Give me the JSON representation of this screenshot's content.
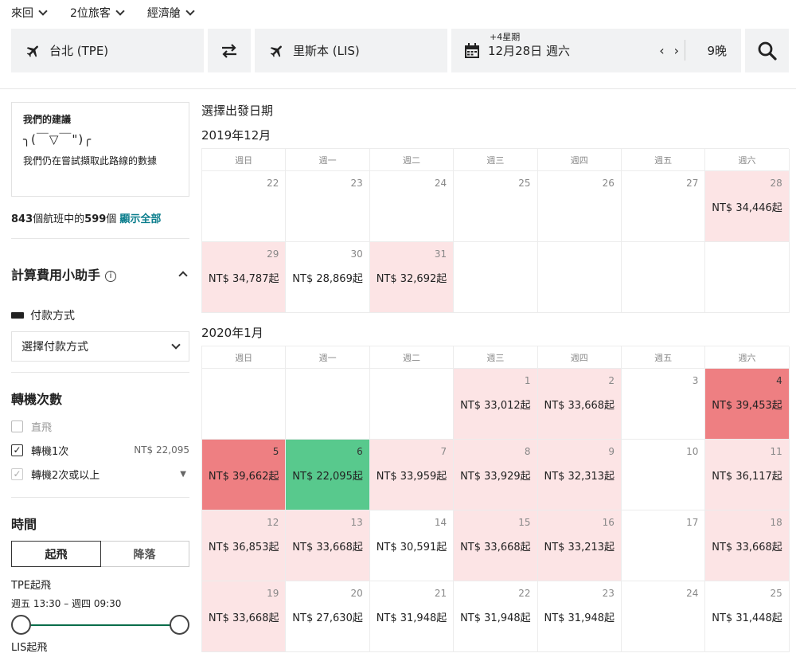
{
  "top_options": {
    "trip_type": "來回",
    "passengers": "2位旅客",
    "cabin": "經濟艙"
  },
  "search": {
    "from": "台北 (TPE)",
    "to": "里斯本 (LIS)",
    "weeks_badge": "+4星期",
    "date": "12月28日 週六",
    "prev": "‹",
    "next": "›",
    "nights": "9晚"
  },
  "sidebar": {
    "suggest_title": "我們的建議",
    "suggest_face": "╮(￣▽￣\")╭",
    "suggest_text": "我們仍在嘗試擷取此路線的數據",
    "count_total": "843",
    "count_mid": "個航班中的",
    "count_shown": "599",
    "count_unit": "個",
    "show_all": "顯示全部",
    "calc_title": "計算費用小助手",
    "pay_label": "付款方式",
    "pay_select": "選擇付款方式",
    "stops_title": "轉機次數",
    "stops": [
      {
        "label": "直飛",
        "checked": false,
        "price": "",
        "dim": true
      },
      {
        "label": "轉機1次",
        "checked": true,
        "price": "NT$ 22,095",
        "dim": false
      },
      {
        "label": "轉機2次或以上",
        "checked": true,
        "price": "",
        "dim": false
      }
    ],
    "time_title": "時間",
    "tab_depart": "起飛",
    "tab_arrive": "降落",
    "tpe_label": "TPE起飛",
    "tpe_range": "週五 13:30 – 週四 09:30",
    "lis_label": "LIS起飛"
  },
  "calendar": {
    "heading": "選擇出發日期",
    "weekdays": [
      "週日",
      "週一",
      "週二",
      "週三",
      "週四",
      "週五",
      "週六"
    ],
    "months": [
      {
        "title": "2019年12月",
        "weeks": [
          [
            {
              "n": "22",
              "p": "",
              "c": ""
            },
            {
              "n": "23",
              "p": "",
              "c": ""
            },
            {
              "n": "24",
              "p": "",
              "c": ""
            },
            {
              "n": "25",
              "p": "",
              "c": ""
            },
            {
              "n": "26",
              "p": "",
              "c": ""
            },
            {
              "n": "27",
              "p": "",
              "c": ""
            },
            {
              "n": "28",
              "p": "NT$ 34,446起",
              "c": "pink"
            }
          ],
          [
            {
              "n": "29",
              "p": "NT$ 34,787起",
              "c": "pink"
            },
            {
              "n": "30",
              "p": "NT$ 28,869起",
              "c": ""
            },
            {
              "n": "31",
              "p": "NT$ 32,692起",
              "c": "pink"
            },
            {
              "n": "",
              "p": "",
              "c": "empty"
            },
            {
              "n": "",
              "p": "",
              "c": "empty"
            },
            {
              "n": "",
              "p": "",
              "c": "empty"
            },
            {
              "n": "",
              "p": "",
              "c": "empty"
            }
          ]
        ]
      },
      {
        "title": "2020年1月",
        "weeks": [
          [
            {
              "n": "",
              "p": "",
              "c": "empty"
            },
            {
              "n": "",
              "p": "",
              "c": "empty"
            },
            {
              "n": "",
              "p": "",
              "c": "empty"
            },
            {
              "n": "1",
              "p": "NT$ 33,012起",
              "c": "pink"
            },
            {
              "n": "2",
              "p": "NT$ 33,668起",
              "c": "pink"
            },
            {
              "n": "3",
              "p": "",
              "c": ""
            },
            {
              "n": "4",
              "p": "NT$ 39,453起",
              "c": "red"
            }
          ],
          [
            {
              "n": "5",
              "p": "NT$ 39,662起",
              "c": "red"
            },
            {
              "n": "6",
              "p": "NT$ 22,095起",
              "c": "green"
            },
            {
              "n": "7",
              "p": "NT$ 33,959起",
              "c": "pink"
            },
            {
              "n": "8",
              "p": "NT$ 33,929起",
              "c": "pink"
            },
            {
              "n": "9",
              "p": "NT$ 32,313起",
              "c": "pink"
            },
            {
              "n": "10",
              "p": "",
              "c": ""
            },
            {
              "n": "11",
              "p": "NT$ 36,117起",
              "c": "pink"
            }
          ],
          [
            {
              "n": "12",
              "p": "NT$ 36,853起",
              "c": "pink"
            },
            {
              "n": "13",
              "p": "NT$ 33,668起",
              "c": "pink"
            },
            {
              "n": "14",
              "p": "NT$ 30,591起",
              "c": ""
            },
            {
              "n": "15",
              "p": "NT$ 33,668起",
              "c": "pink"
            },
            {
              "n": "16",
              "p": "NT$ 33,213起",
              "c": "pink"
            },
            {
              "n": "17",
              "p": "",
              "c": ""
            },
            {
              "n": "18",
              "p": "NT$ 33,668起",
              "c": "pink"
            }
          ],
          [
            {
              "n": "19",
              "p": "NT$ 33,668起",
              "c": "pink"
            },
            {
              "n": "20",
              "p": "NT$ 27,630起",
              "c": ""
            },
            {
              "n": "21",
              "p": "NT$ 31,948起",
              "c": ""
            },
            {
              "n": "22",
              "p": "NT$ 31,948起",
              "c": ""
            },
            {
              "n": "23",
              "p": "NT$ 31,948起",
              "c": ""
            },
            {
              "n": "24",
              "p": "",
              "c": ""
            },
            {
              "n": "25",
              "p": "NT$ 31,448起",
              "c": ""
            }
          ]
        ]
      }
    ]
  }
}
